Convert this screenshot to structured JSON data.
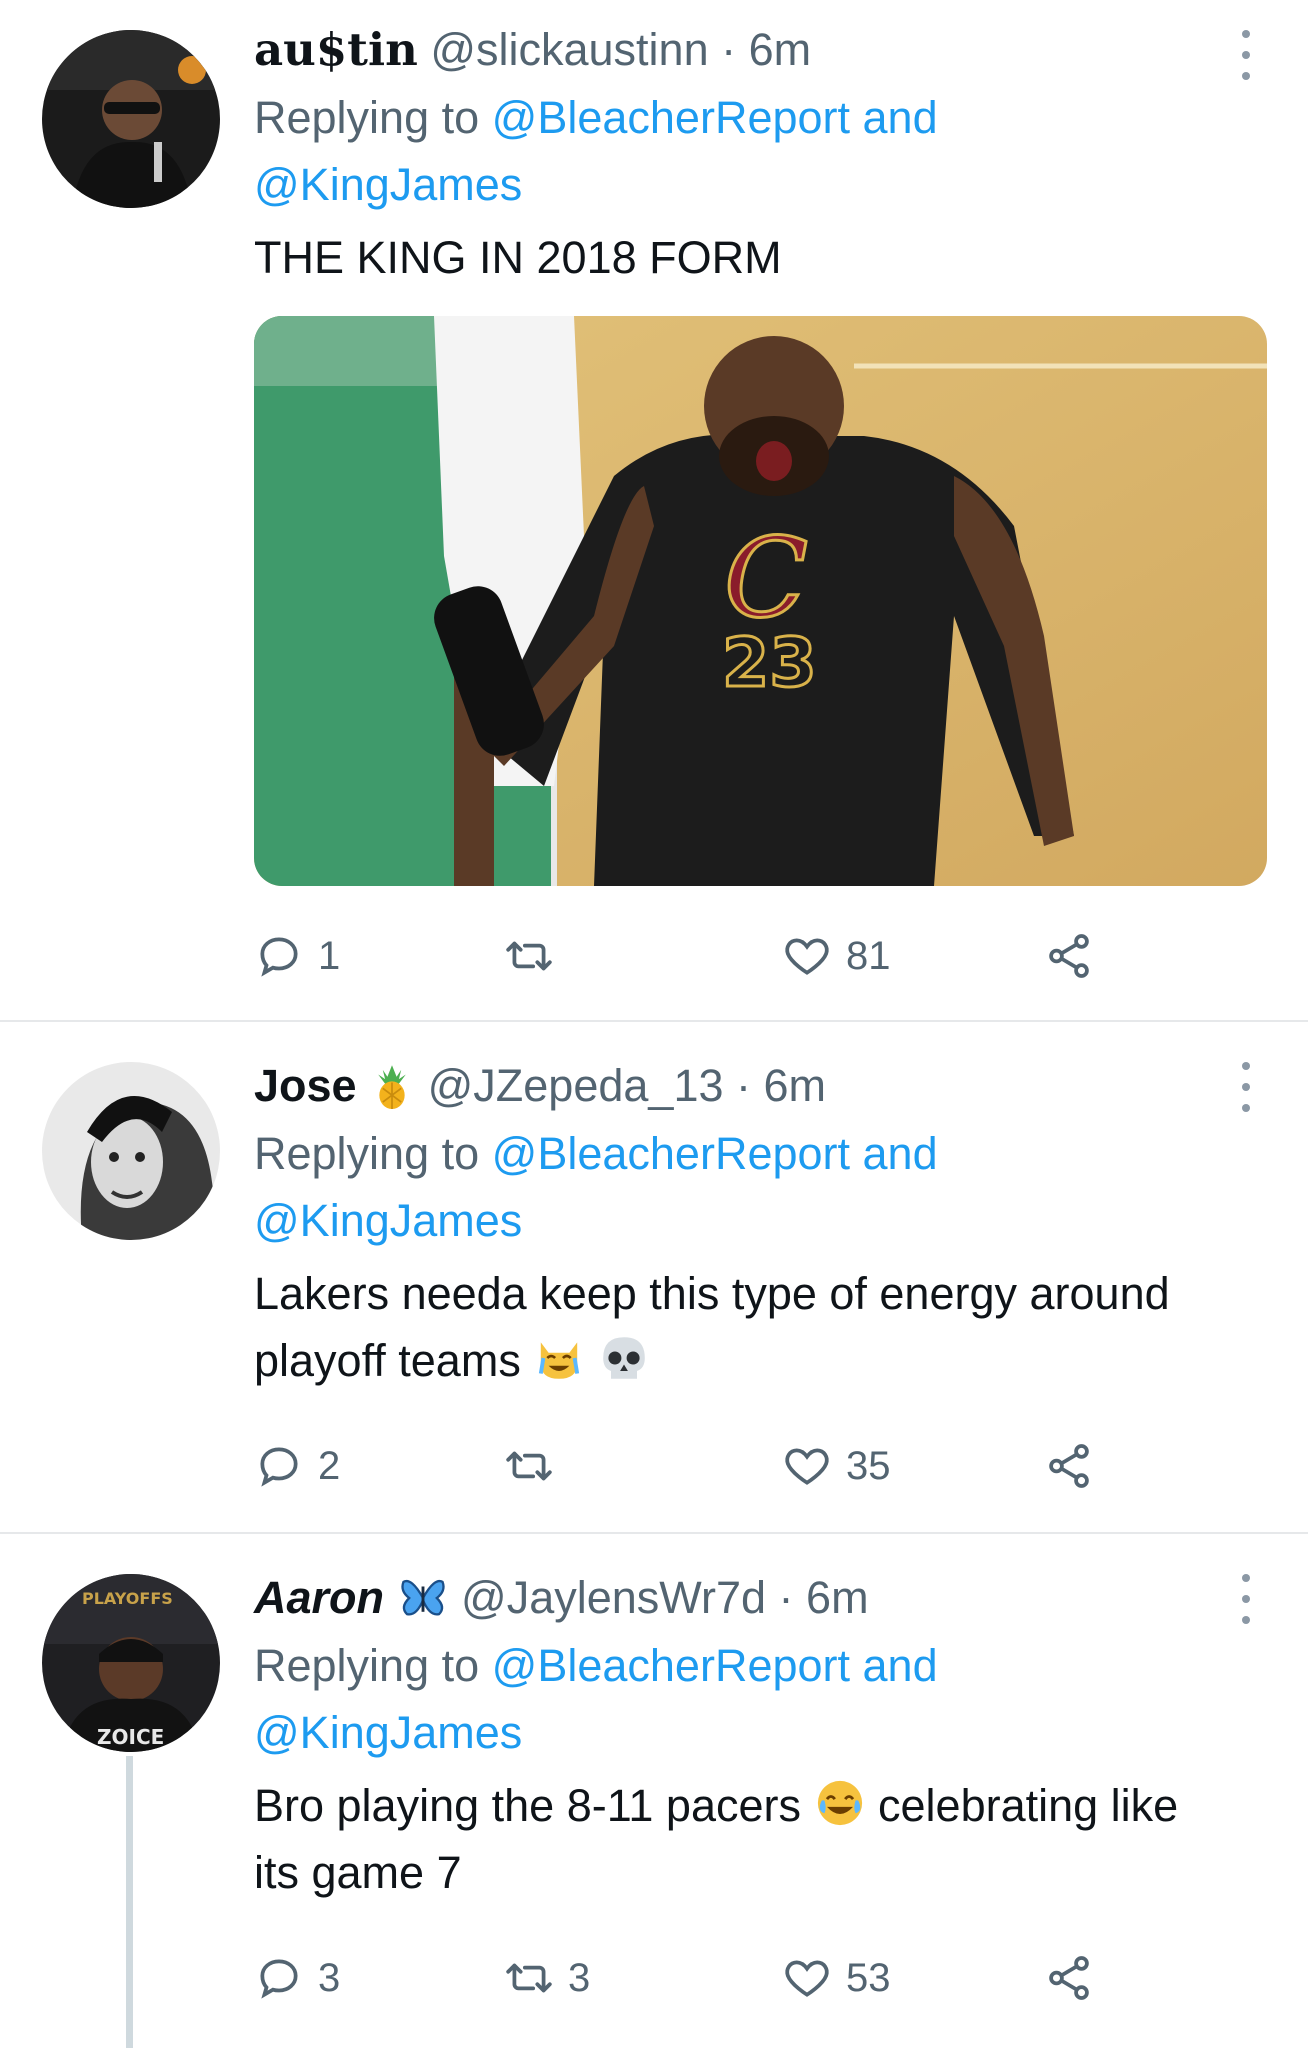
{
  "tweets": [
    {
      "display_name": "au$tin",
      "handle": "@slickaustinn",
      "separator": "·",
      "time": "6m",
      "replying_prefix": "Replying to",
      "mention_1": "@BleacherReport",
      "mention_joiner": "and",
      "mention_2": "@KingJames",
      "text": "THE KING IN 2018 FORM",
      "replies": "1",
      "retweets": "",
      "likes": "81",
      "photo_jersey_number": "23"
    },
    {
      "display_name": "Jose",
      "name_emoji": "pineapple",
      "handle": "@JZepeda_13",
      "separator": "·",
      "time": "6m",
      "replying_prefix": "Replying to",
      "mention_1": "@BleacherReport",
      "mention_joiner": "and",
      "mention_2": "@KingJames",
      "text_line_1": "Lakers needa keep this type of energy around",
      "text_line_2": "playoff teams",
      "text_emojis": [
        "crying-cat",
        "skull"
      ],
      "replies": "2",
      "retweets": "",
      "likes": "35"
    },
    {
      "display_name": "Aaron",
      "name_emoji": "butterfly",
      "handle": "@JaylensWr7d",
      "separator": "·",
      "time": "6m",
      "replying_prefix": "Replying to",
      "mention_1": "@BleacherReport",
      "mention_joiner": "and",
      "mention_2": "@KingJames",
      "text_part_1": "Bro playing the 8-11 pacers",
      "text_emoji": "tears-of-joy",
      "text_part_2": "celebrating like",
      "text_line_2": "its game 7",
      "replies": "3",
      "retweets": "3",
      "likes": "53"
    }
  ],
  "colors": {
    "link": "#1d9bf0",
    "secondary": "#536471",
    "primary": "#0f1419",
    "divider": "#e6e8ea"
  },
  "icons": [
    "reply-icon",
    "retweet-icon",
    "like-icon",
    "share-icon",
    "more-icon"
  ]
}
